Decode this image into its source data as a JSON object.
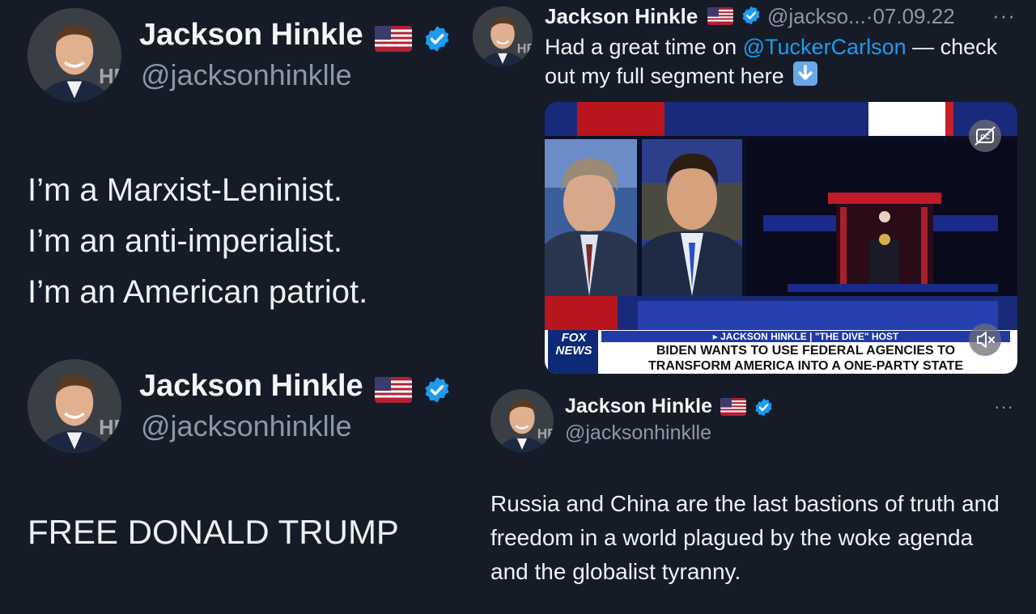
{
  "colors": {
    "background": "#151c28",
    "link": "#1d9bf0",
    "verified": "#1d9bf0",
    "muted": "#8b98a5"
  },
  "tweets": [
    {
      "name": "Jackson Hinkle",
      "handle": "@jacksonhinklle",
      "flag": "us-flag-emoji",
      "verified": true,
      "lines": [
        "I’m a Marxist-Leninist.",
        "I’m an anti-imperialist.",
        "I’m an American patriot."
      ]
    },
    {
      "name": "Jackson Hinkle",
      "handle": "@jackso...",
      "separator": "·",
      "date": "07.09.22",
      "more": "···",
      "text_before": "Had a great time on ",
      "mention": "@TuckerCarlson",
      "text_after": " — check out my full segment here",
      "emoji": "down-arrow-emoji",
      "media": {
        "chyron_name": "▸ JACKSON HINKLE",
        "chyron_sep": " | ",
        "chyron_role": "\"THE DIVE\" HOST",
        "headline_1": "BIDEN WANTS TO USE FEDERAL AGENCIES TO",
        "headline_2": "TRANSFORM AMERICA INTO A ONE-PARTY STATE",
        "logo_top": "FOX",
        "logo_bottom": "NEWS",
        "cc_icon": "closed-captions-off-icon",
        "mute_icon": "speaker-muted-icon"
      }
    },
    {
      "name": "Jackson Hinkle",
      "handle": "@jacksonhinklle",
      "verified": true,
      "text": "FREE DONALD TRUMP"
    },
    {
      "name": "Jackson Hinkle",
      "handle": "@jacksonhinklle",
      "verified": true,
      "more": "···",
      "text": "Russia and China are the last bastions of truth and freedom in a world plagued by the woke agenda and the globalist tyranny."
    }
  ]
}
